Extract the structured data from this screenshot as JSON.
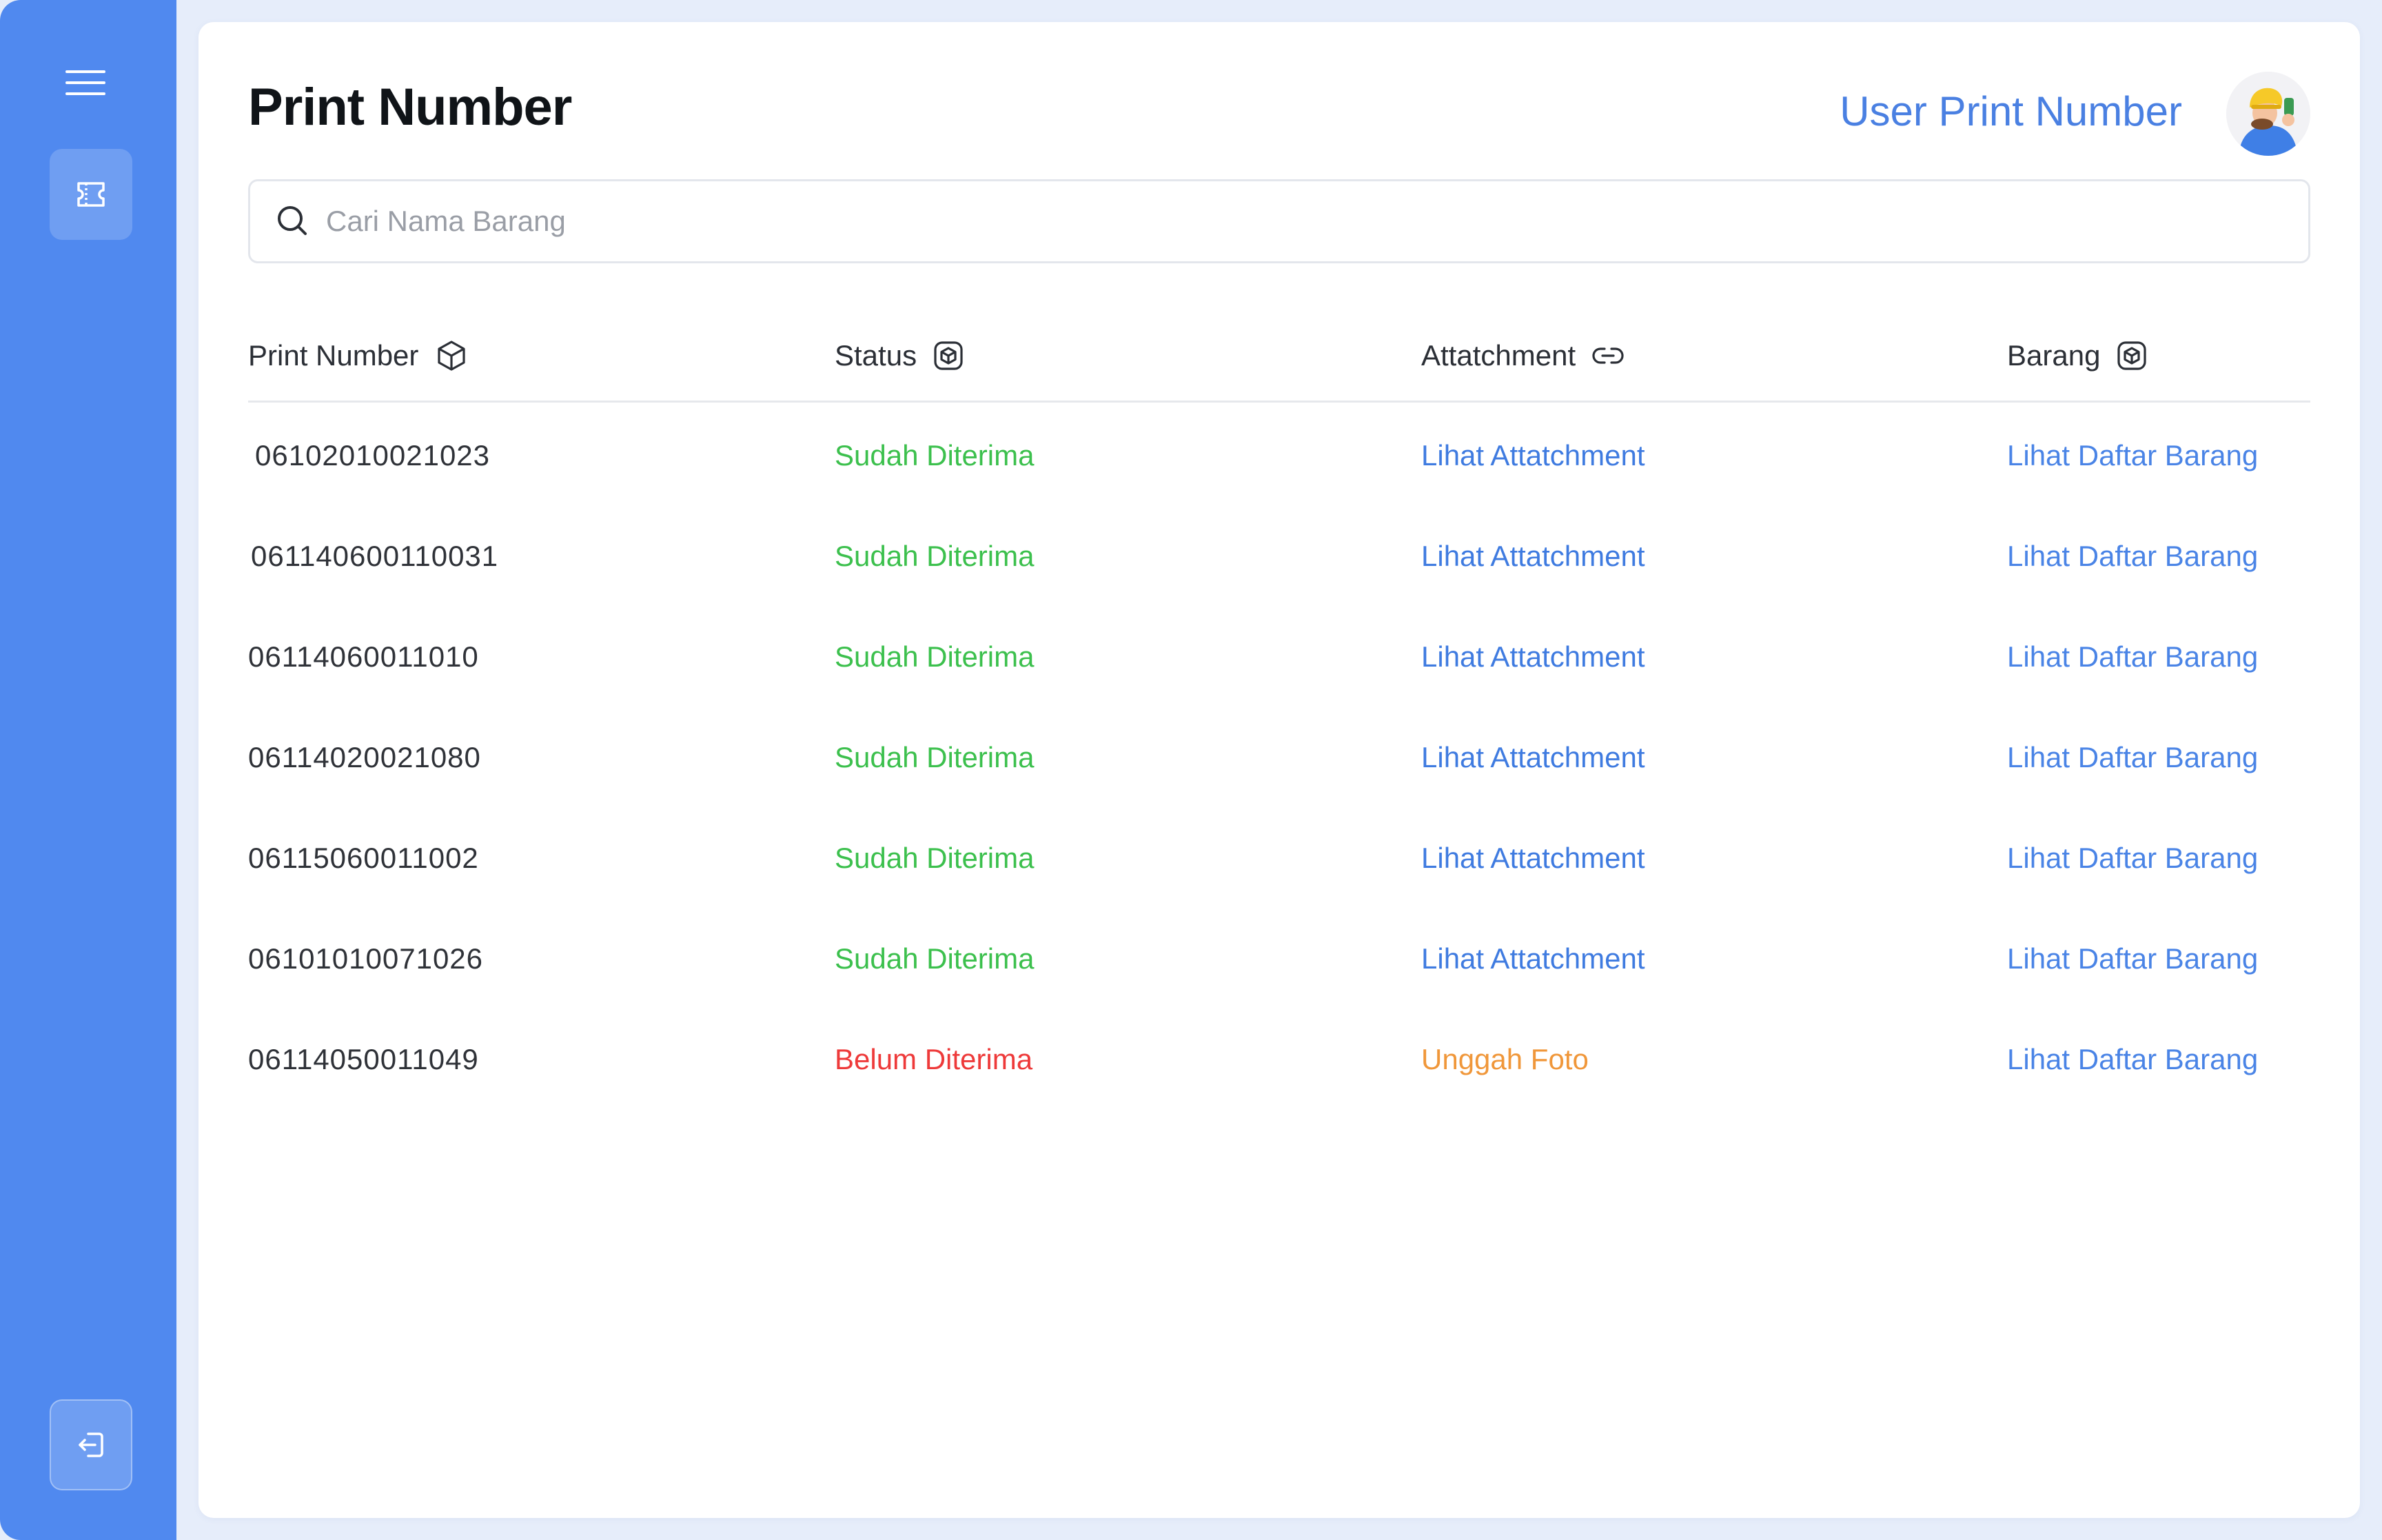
{
  "header": {
    "title": "Print Number",
    "user_label": "User Print Number"
  },
  "search": {
    "placeholder": "Cari Nama Barang",
    "value": ""
  },
  "table": {
    "columns": [
      {
        "label": "Print Number",
        "icon": "cube-icon"
      },
      {
        "label": "Status",
        "icon": "box-icon"
      },
      {
        "label": "Attatchment",
        "icon": "link-icon"
      },
      {
        "label": "Barang",
        "icon": "box-icon"
      }
    ],
    "rows": [
      {
        "number": "06102010021023",
        "status": "Sudah Diterima",
        "status_type": "received",
        "attachment": "Lihat Attatchment",
        "barang": "Lihat Daftar Barang"
      },
      {
        "number": "061140600110031",
        "status": "Sudah Diterima",
        "status_type": "received",
        "attachment": "Lihat Attatchment",
        "barang": "Lihat Daftar Barang"
      },
      {
        "number": "06114060011010",
        "status": "Sudah Diterima",
        "status_type": "received",
        "attachment": "Lihat Attatchment",
        "barang": "Lihat Daftar Barang"
      },
      {
        "number": "06114020021080",
        "status": "Sudah Diterima",
        "status_type": "received",
        "attachment": "Lihat Attatchment",
        "barang": "Lihat Daftar Barang"
      },
      {
        "number": "06115060011002",
        "status": "Sudah Diterima",
        "status_type": "received",
        "attachment": "Lihat Attatchment",
        "barang": "Lihat Daftar Barang"
      },
      {
        "number": "06101010071026",
        "status": "Sudah Diterima",
        "status_type": "received",
        "attachment": "Lihat Attatchment",
        "barang": "Lihat Daftar Barang"
      },
      {
        "number": "06114050011049",
        "status": "Belum Diterima",
        "status_type": "pending",
        "attachment": "Unggah Foto",
        "barang": "Lihat Daftar Barang"
      }
    ]
  },
  "sidebar": {
    "items": [
      {
        "icon": "menu-icon"
      },
      {
        "icon": "ticket-icon"
      },
      {
        "icon": "logout-icon"
      }
    ]
  },
  "colors": {
    "sidebar": "#5089ef",
    "received": "#3cc04d",
    "pending": "#ee3a3a",
    "link": "#3f7be0",
    "upload": "#f0973a"
  }
}
